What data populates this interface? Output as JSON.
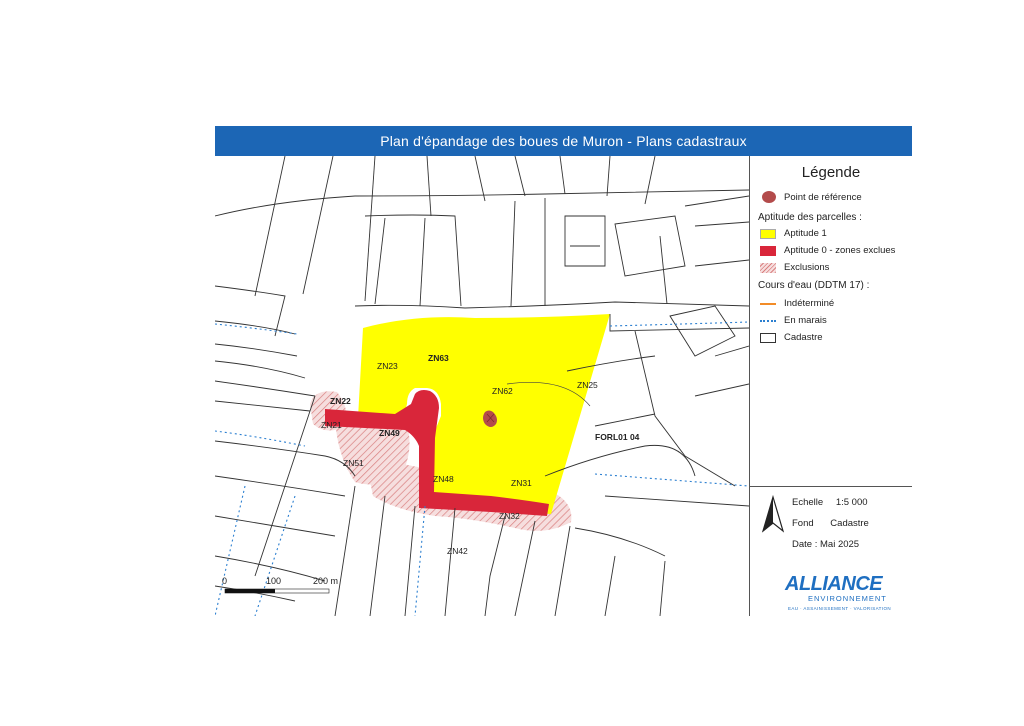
{
  "title": "Plan d'épandage des boues de Muron - Plans cadastraux",
  "legend": {
    "heading": "Légende",
    "reference_point": "Point de référence",
    "aptitude_heading": "Aptitude des parcelles :",
    "aptitude1": "Aptitude 1",
    "aptitude0": "Aptitude 0 - zones exclues",
    "exclusions": "Exclusions",
    "water_heading": "Cours d'eau (DDTM 17) :",
    "water_undetermined": "Indéterminé",
    "water_marsh": "En marais",
    "cadastre": "Cadastre"
  },
  "info": {
    "scale_label": "Echelle",
    "scale_value": "1:5 000",
    "fond_label": "Fond",
    "fond_value": "Cadastre",
    "date_label": "Date",
    "date_value": "Mai 2025",
    "logo_name": "ALLIANCE",
    "logo_sub": "ENVIRONNEMENT",
    "logo_tagline": "EAU · ASSAINISSEMENT · VALORISATION"
  },
  "map": {
    "parcels": {
      "zn23": "ZN23",
      "zn63": "ZN63",
      "zn62": "ZN62",
      "zn25": "ZN25",
      "zn22": "ZN22",
      "zn21": "ZN21",
      "zn49": "ZN49",
      "zn51": "ZN51",
      "zn48": "ZN48",
      "zn31": "ZN31",
      "zn32": "ZN32",
      "zn42": "ZN42"
    },
    "reference_label": "FORL01 04",
    "scalebar": {
      "t0": "0",
      "t1": "100",
      "t2": "200 m"
    }
  },
  "colors": {
    "title_bar": "#1c66b5",
    "aptitude1": "#ffff00",
    "aptitude0": "#d9263a",
    "exclusion_hatch": "#e08a8a",
    "reference_point": "#b34b4b",
    "water_undetermined": "#f28c28",
    "water_marsh": "#2b7fd0",
    "logo": "#1f6fc1"
  }
}
